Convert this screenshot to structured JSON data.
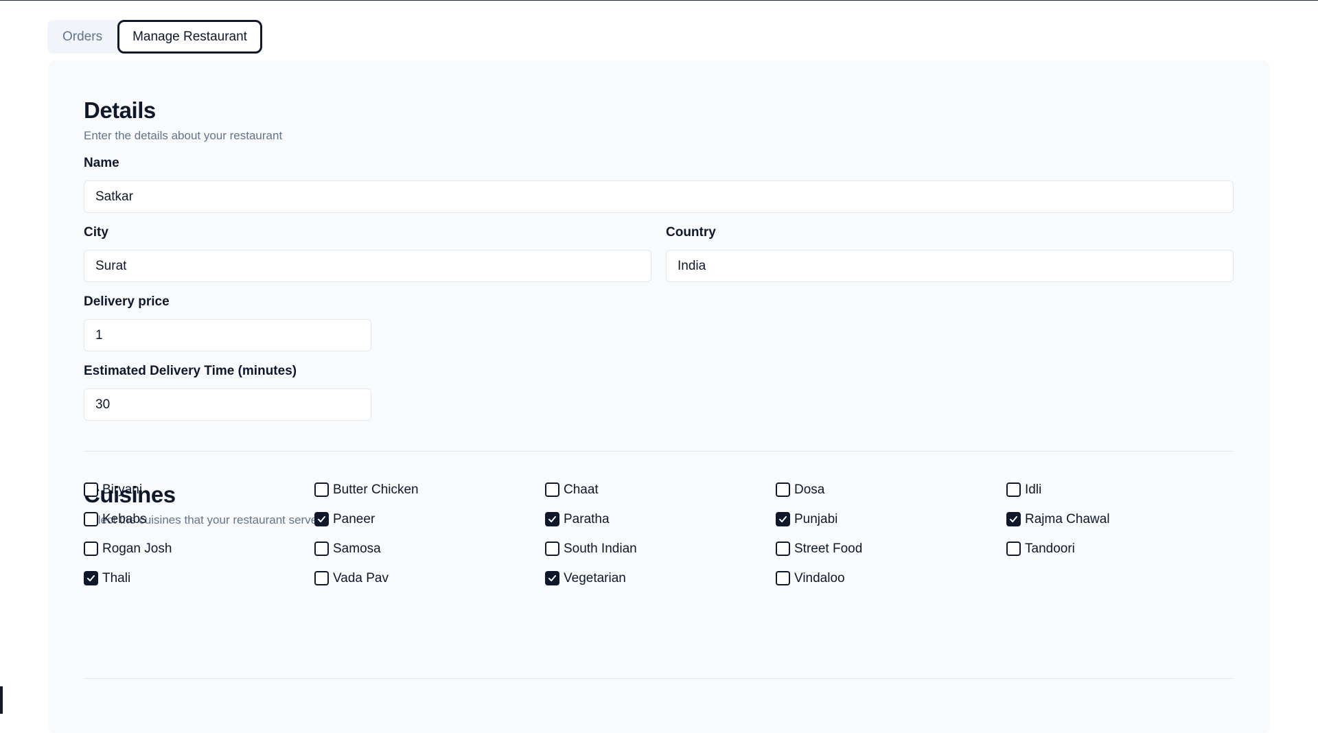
{
  "tabs": [
    {
      "label": "Orders",
      "active": false
    },
    {
      "label": "Manage Restaurant",
      "active": true
    }
  ],
  "details": {
    "title": "Details",
    "subtitle": "Enter the details about your restaurant",
    "name": {
      "label": "Name",
      "value": "Satkar"
    },
    "city": {
      "label": "City",
      "value": "Surat"
    },
    "country": {
      "label": "Country",
      "value": "India"
    },
    "delivery_price": {
      "label": "Delivery price",
      "value": "1"
    },
    "delivery_time": {
      "label": "Estimated Delivery Time (minutes)",
      "value": "30"
    }
  },
  "cuisines": {
    "title": "Cuisines",
    "subtitle": "Select the cuisines that your restaurant serves",
    "items": [
      {
        "label": "Biryani",
        "checked": false
      },
      {
        "label": "Butter Chicken",
        "checked": false
      },
      {
        "label": "Chaat",
        "checked": false
      },
      {
        "label": "Dosa",
        "checked": false
      },
      {
        "label": "Idli",
        "checked": false
      },
      {
        "label": "Kebabs",
        "checked": false
      },
      {
        "label": "Paneer",
        "checked": true
      },
      {
        "label": "Paratha",
        "checked": true
      },
      {
        "label": "Punjabi",
        "checked": true
      },
      {
        "label": "Rajma Chawal",
        "checked": true
      },
      {
        "label": "Rogan Josh",
        "checked": false
      },
      {
        "label": "Samosa",
        "checked": false
      },
      {
        "label": "South Indian",
        "checked": false
      },
      {
        "label": "Street Food",
        "checked": false
      },
      {
        "label": "Tandoori",
        "checked": false
      },
      {
        "label": "Thali",
        "checked": true
      },
      {
        "label": "Vada Pav",
        "checked": false
      },
      {
        "label": "Vegetarian",
        "checked": true
      },
      {
        "label": "Vindaloo",
        "checked": false
      }
    ]
  }
}
